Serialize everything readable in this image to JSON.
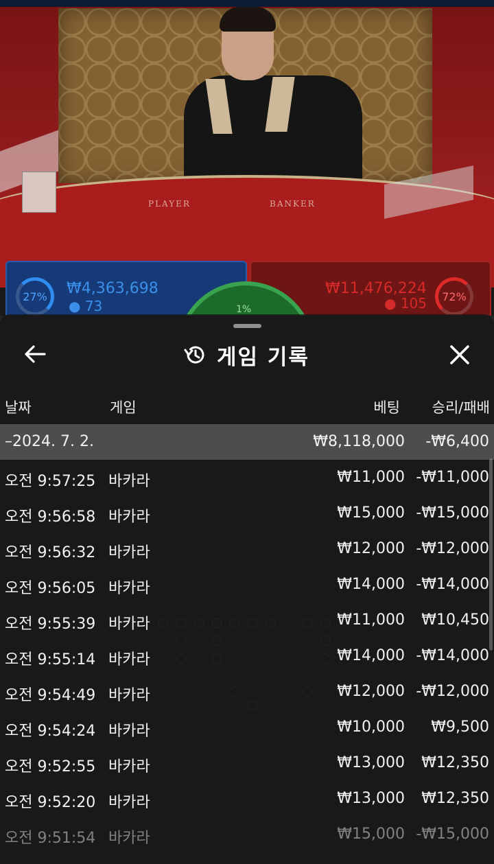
{
  "background": {
    "felt_labels": {
      "player": "PLAYER",
      "banker": "BANKER"
    },
    "player_panel": {
      "percent": "27%",
      "amount": "₩4,363,698",
      "count": "73"
    },
    "banker_panel": {
      "percent": "72%",
      "amount": "₩11,476,224",
      "count": "105"
    },
    "tie_percent": "1%"
  },
  "modal": {
    "title": "게임 기록",
    "icons": {
      "back": "arrow-left-icon",
      "history": "history-icon",
      "close": "close-icon"
    },
    "columns": {
      "date": "날짜",
      "game": "게임",
      "bet": "베팅",
      "result": "승리/패배"
    },
    "summary": {
      "date": "–2024. 7. 2.",
      "bet": "₩8,118,000",
      "result": "-₩6,400"
    },
    "rows": [
      {
        "time": "오전 9:57:25",
        "game": "바카라",
        "bet": "₩11,000",
        "result": "-₩11,000"
      },
      {
        "time": "오전 9:56:58",
        "game": "바카라",
        "bet": "₩15,000",
        "result": "-₩15,000"
      },
      {
        "time": "오전 9:56:32",
        "game": "바카라",
        "bet": "₩12,000",
        "result": "-₩12,000"
      },
      {
        "time": "오전 9:56:05",
        "game": "바카라",
        "bet": "₩14,000",
        "result": "-₩14,000"
      },
      {
        "time": "오전 9:55:39",
        "game": "바카라",
        "bet": "₩11,000",
        "result": "₩10,450"
      },
      {
        "time": "오전 9:55:14",
        "game": "바카라",
        "bet": "₩14,000",
        "result": "-₩14,000"
      },
      {
        "time": "오전 9:54:49",
        "game": "바카라",
        "bet": "₩12,000",
        "result": "-₩12,000"
      },
      {
        "time": "오전 9:54:24",
        "game": "바카라",
        "bet": "₩10,000",
        "result": "₩9,500"
      },
      {
        "time": "오전 9:52:55",
        "game": "바카라",
        "bet": "₩13,000",
        "result": "₩12,350"
      },
      {
        "time": "오전 9:52:20",
        "game": "바카라",
        "bet": "₩13,000",
        "result": "₩12,350"
      },
      {
        "time": "오전 9:51:54",
        "game": "바카라",
        "bet": "₩15,000",
        "result": "-₩15,000"
      }
    ]
  }
}
